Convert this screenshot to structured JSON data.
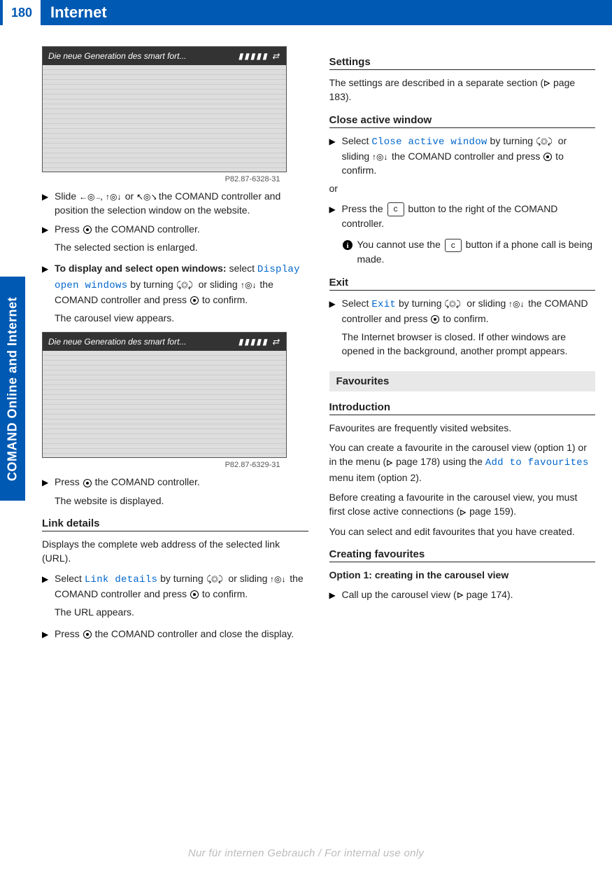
{
  "header": {
    "page_num": "180",
    "title": "Internet"
  },
  "side_tab": "COMAND Online and Internet",
  "figures": {
    "f1": {
      "caption": "Die neue Generation des smart fort...",
      "id": "P82.87-6328-31"
    },
    "f2": {
      "caption": "Die neue Generation des smart fort...",
      "id": "P82.87-6329-31"
    }
  },
  "left": {
    "step1_a": "Slide ",
    "step1_b": ", ",
    "step1_c": " or ",
    "step1_d": " the COMAND controller and position the selection window on the website.",
    "step2_a": "Press ",
    "step2_b": " the COMAND controller.",
    "step2_res": "The selected section is enlarged.",
    "step3_title": "To display and select open windows:",
    "step3_a": " select ",
    "step3_menu": "Display open windows",
    "step3_b": " by turning ",
    "step3_c": " or sliding ",
    "step3_d": " the COMAND controller and press ",
    "step3_e": " to confirm.",
    "step3_res": "The carousel view appears.",
    "step4_a": "Press ",
    "step4_b": " the COMAND controller.",
    "step4_res": "The website is displayed.",
    "h_link": "Link details",
    "link_p": "Displays the complete web address of the selected link (URL).",
    "link_s1_a": "Select ",
    "link_s1_menu": "Link details",
    "link_s1_b": " by turning ",
    "link_s1_c": " or sliding ",
    "link_s1_d": " the COMAND controller and press ",
    "link_s1_e": " to confirm.",
    "link_s1_res": "The URL appears.",
    "link_s2_a": "Press ",
    "link_s2_b": " the COMAND controller and close the display."
  },
  "right": {
    "h_set": "Settings",
    "set_p_a": "The settings are described in a separate section (",
    "set_p_b": " page 183).",
    "h_close": "Close active window",
    "close_s1_a": "Select ",
    "close_s1_menu": "Close active window",
    "close_s1_b": " by turning ",
    "close_s1_c": " or sliding ",
    "close_s1_d": " the COMAND controller and press ",
    "close_s1_e": " to confirm.",
    "or": "or",
    "close_s2_a": "Press the ",
    "close_s2_key": "c",
    "close_s2_b": " button to the right of the COMAND controller.",
    "info_a": "You cannot use the ",
    "info_key": "c",
    "info_b": " button if a phone call is being made.",
    "h_exit": "Exit",
    "exit_s1_a": "Select ",
    "exit_s1_menu": "Exit",
    "exit_s1_b": " by turning ",
    "exit_s1_c": " or sliding ",
    "exit_s1_d": " the COMAND controller and press ",
    "exit_s1_e": " to confirm.",
    "exit_res": "The Internet browser is closed. If other windows are opened in the background, another prompt appears.",
    "sec_fav": "Favourites",
    "h_intro": "Introduction",
    "intro_p1": "Favourites are frequently visited websites.",
    "intro_p2_a": "You can create a favourite in the carousel view (option 1) or in the menu (",
    "intro_p2_b": " page 178) using the ",
    "intro_p2_menu": "Add to favourites",
    "intro_p2_c": " menu item (option 2).",
    "intro_p3_a": "Before creating a favourite in the carousel view, you must first close active connections (",
    "intro_p3_b": " page 159).",
    "intro_p4": "You can select and edit favourites that you have created.",
    "h_create": "Creating favourites",
    "opt1_title": "Option 1: creating in the carousel view",
    "opt1_s1_a": "Call up the carousel view (",
    "opt1_s1_b": " page 174)."
  },
  "watermark": "Nur für internen Gebrauch / For internal use only"
}
